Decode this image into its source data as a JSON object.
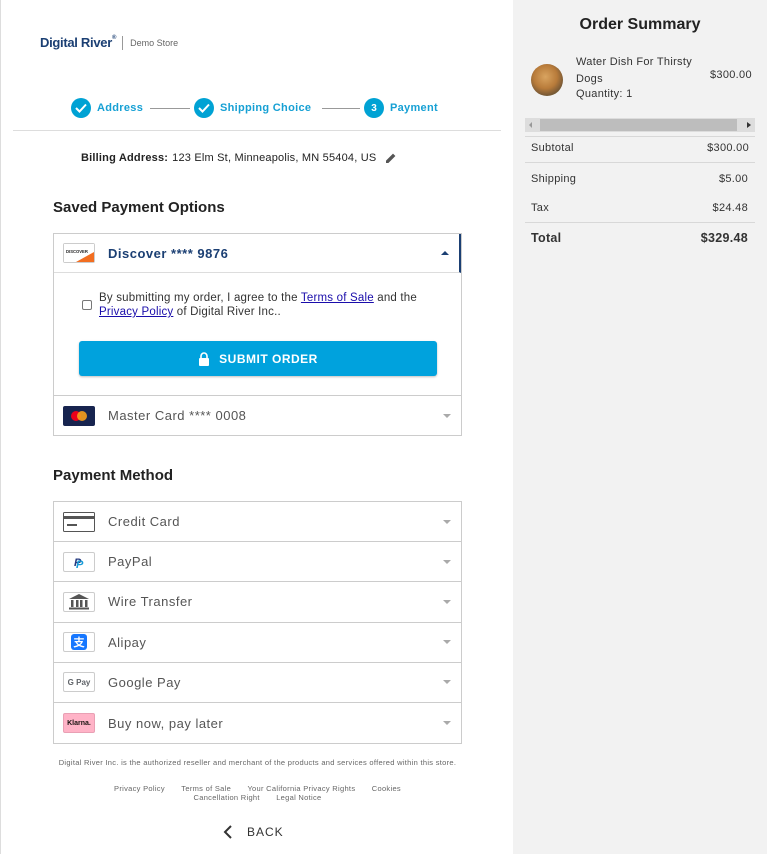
{
  "logo": {
    "brand": "Digital River",
    "tm": "®",
    "store": "Demo Store"
  },
  "stepper": [
    {
      "label": "Address",
      "marker": ""
    },
    {
      "label": "Shipping Choice",
      "marker": ""
    },
    {
      "label": "Payment",
      "marker": "3"
    }
  ],
  "billing": {
    "label": "Billing Address:",
    "value": "123 Elm St, Minneapolis, MN 55404, US"
  },
  "saved_payment": {
    "title": "Saved Payment Options",
    "selected": {
      "label": "Discover **** 9876",
      "icon": "discover-card-icon"
    },
    "agree_prefix": "By submitting my order, I agree to the ",
    "terms_link": "Terms of Sale",
    "agree_mid": " and the ",
    "privacy_link": "Privacy Policy",
    "agree_suffix": " of Digital River Inc..",
    "submit_label": "SUBMIT ORDER",
    "other": {
      "label": "Master Card **** 0008",
      "icon": "mastercard-icon"
    }
  },
  "payment_method": {
    "title": "Payment Method",
    "options": [
      {
        "label": "Credit Card",
        "icon": "credit-card-icon"
      },
      {
        "label": "PayPal",
        "icon": "paypal-icon"
      },
      {
        "label": "Wire Transfer",
        "icon": "bank-icon"
      },
      {
        "label": "Alipay",
        "icon": "alipay-icon"
      },
      {
        "label": "Google Pay",
        "icon": "google-pay-icon",
        "badge": "G Pay"
      },
      {
        "label": "Buy now, pay later",
        "icon": "klarna-icon",
        "badge": "Klarna."
      }
    ]
  },
  "footer": {
    "note": "Digital River Inc. is the authorized reseller and merchant of the products and services offered within this store.",
    "links": [
      "Privacy Policy",
      "Terms of Sale",
      "Your California Privacy Rights",
      "Cookies",
      "Cancellation Right",
      "Legal Notice"
    ],
    "back_label": "BACK"
  },
  "order_summary": {
    "title": "Order Summary",
    "product": {
      "name": "Water Dish For Thirsty Dogs",
      "price": "$300.00",
      "quantity": "Quantity: 1"
    },
    "subtotal_label": "Subtotal",
    "subtotal": "$300.00",
    "shipping_label": "Shipping",
    "shipping": "$5.00",
    "tax_label": "Tax",
    "tax": "$24.48",
    "total_label": "Total",
    "total": "$329.48"
  },
  "colors": {
    "accent": "#00a2dd",
    "brand": "#1b3f73",
    "link": "#1a0dab"
  }
}
